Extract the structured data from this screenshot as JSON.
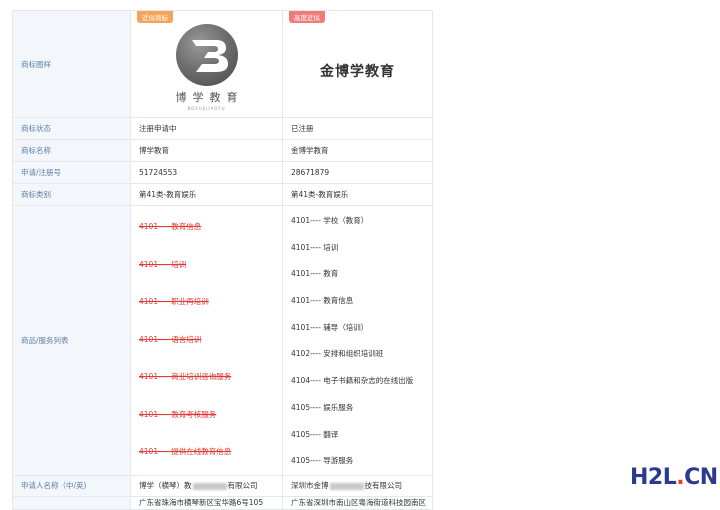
{
  "rows": {
    "logo": {
      "label": "商标图样",
      "a": {
        "tag": "近似商标",
        "logo_cn": "博学教育",
        "logo_en": "BOXUEJIAOYU",
        "icon": "b-logo-icon"
      },
      "b": {
        "tag": "高度近似",
        "wordmark": "金博学教育"
      }
    },
    "status": {
      "label": "商标状态",
      "a": "注册申请中",
      "b": "已注册"
    },
    "name": {
      "label": "商标名称",
      "a": "博学教育",
      "b": "金博学教育"
    },
    "reg_no": {
      "label": "申请/注册号",
      "a": "51724553",
      "b": "28671879"
    },
    "class": {
      "label": "商标类别",
      "a": "第41类-教育娱乐",
      "b": "第41类-教育娱乐"
    },
    "services": {
      "label": "商品/服务列表",
      "a": [
        "4101---- 教育信息",
        "4101---- 培训",
        "4101---- 职业再培训",
        "4101---- 语言培训",
        "4101---- 商业培训咨询服务",
        "4101---- 教育考核服务",
        "4101---- 提供在线教育信息"
      ],
      "b": [
        "4101---- 学校（教育）",
        "4101---- 培训",
        "4101---- 教育",
        "4101---- 教育信息",
        "4101---- 辅导（培训）",
        "4102---- 安排和组织培训班",
        "4104---- 电子书籍和杂志的在线出版",
        "4105---- 娱乐服务",
        "4105---- 翻译",
        "4105---- 导游服务"
      ]
    },
    "applicant": {
      "label": "申请人名称（中/英)",
      "a_prefix": "博学（横琴）教",
      "a_suffix": "有限公司",
      "b_prefix": "深圳市金博",
      "b_suffix": "技有限公司"
    },
    "address": {
      "a": "广东省珠海市横琴新区宝华路6号105",
      "b": "广东省深圳市南山区粤海街道科技园南区"
    }
  },
  "watermark": {
    "h2l": "H2L",
    "dot": ".",
    "cn": "CN"
  },
  "colors": {
    "struck": "#e53935",
    "label": "#5e7fa8",
    "label_bg": "#f3f7fc"
  }
}
